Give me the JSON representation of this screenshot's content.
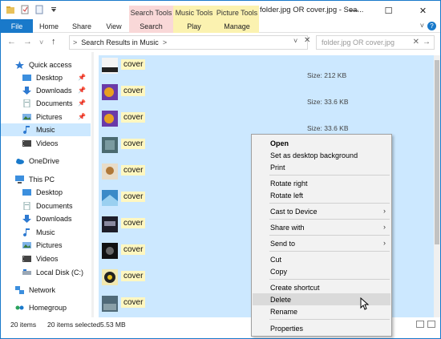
{
  "window": {
    "title": "folder.jpg OR cover.jpg - Sea...",
    "controls": {
      "minimize": "—",
      "maximize": "☐",
      "close": "✕"
    }
  },
  "ribbon": {
    "context_headers": {
      "search_tools": "Search Tools",
      "music_tools": "Music Tools",
      "picture_tools": "Picture Tools"
    },
    "tabs": {
      "file": "File",
      "home": "Home",
      "share": "Share",
      "view": "View",
      "search": "Search",
      "play": "Play",
      "manage": "Manage"
    },
    "collapse_glyph": "˅",
    "help_glyph": "?"
  },
  "addressbar": {
    "back": "←",
    "forward": "→",
    "recent": "˅",
    "up": "↑",
    "path": "Search Results in Music",
    "chevron": ">",
    "dropdown": "˅",
    "refresh": "✕",
    "search_value": "folder.jpg OR cover.jpg",
    "search_clear": "✕",
    "search_go": "→"
  },
  "navpane": {
    "quick_access": "Quick access",
    "desktop": "Desktop",
    "downloads": "Downloads",
    "documents": "Documents",
    "pictures": "Pictures",
    "music": "Music",
    "videos": "Videos",
    "onedrive": "OneDrive",
    "this_pc": "This PC",
    "pc_desktop": "Desktop",
    "pc_documents": "Documents",
    "pc_downloads": "Downloads",
    "pc_music": "Music",
    "pc_pictures": "Pictures",
    "pc_videos": "Videos",
    "local_disk": "Local Disk (C:)",
    "network": "Network",
    "homegroup": "Homegroup",
    "pin": "📌"
  },
  "files": [
    {
      "name": "cover",
      "size": "Size: 212 KB"
    },
    {
      "name": "cover",
      "size": "Size: 33.6 KB"
    },
    {
      "name": "cover",
      "size": "Size: 33.6 KB"
    },
    {
      "name": "cover",
      "size": ""
    },
    {
      "name": "cover",
      "size": ""
    },
    {
      "name": "cover",
      "size": ""
    },
    {
      "name": "cover",
      "size": ""
    },
    {
      "name": "cover",
      "size": ""
    },
    {
      "name": "cover",
      "size": ""
    },
    {
      "name": "cover",
      "size": ""
    }
  ],
  "statusbar": {
    "items": "20 items",
    "selected": "20 items selected",
    "size": "5.53 MB"
  },
  "context_menu": {
    "open": "Open",
    "set_background": "Set as desktop background",
    "print": "Print",
    "rotate_right": "Rotate right",
    "rotate_left": "Rotate left",
    "cast": "Cast to Device",
    "share_with": "Share with",
    "send_to": "Send to",
    "cut": "Cut",
    "copy": "Copy",
    "create_shortcut": "Create shortcut",
    "delete": "Delete",
    "rename": "Rename",
    "properties": "Properties",
    "submenu_arrow": "›"
  },
  "colors": {
    "accent": "#1979ca",
    "selection": "#cce8ff",
    "highlight": "#fff7c0"
  }
}
